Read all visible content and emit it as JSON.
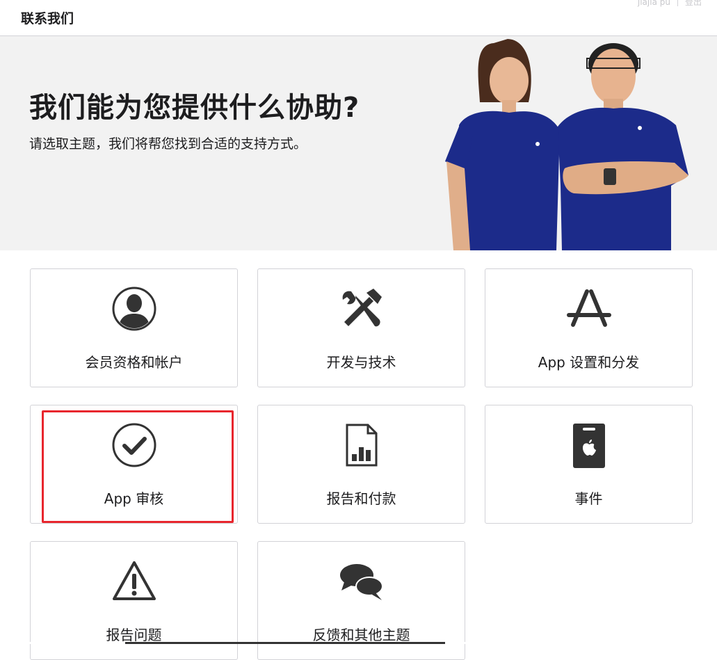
{
  "header": {
    "title": "联系我们",
    "user_name": "jiajia pu",
    "logout_label": "登出"
  },
  "hero": {
    "heading": "我们能为您提供什么协助?",
    "subheading": "请选取主题，我们将帮您找到合适的支持方式。"
  },
  "cards": [
    {
      "label": "会员资格和帐户",
      "icon": "user-circle-icon"
    },
    {
      "label": "开发与技术",
      "icon": "tools-icon"
    },
    {
      "label": "App 设置和分发",
      "icon": "app-store-icon"
    },
    {
      "label": "App 审核",
      "icon": "checkmark-circle-icon"
    },
    {
      "label": "报告和付款",
      "icon": "report-chart-icon"
    },
    {
      "label": "事件",
      "icon": "event-badge-icon"
    },
    {
      "label": "报告问题",
      "icon": "warning-triangle-icon"
    },
    {
      "label": "反馈和其他主题",
      "icon": "chat-bubbles-icon"
    }
  ],
  "colors": {
    "accent_highlight": "#e8262d",
    "hero_background": "#f2f2f2",
    "shirt_blue": "#1c2b8a",
    "icon_color": "#333333"
  }
}
